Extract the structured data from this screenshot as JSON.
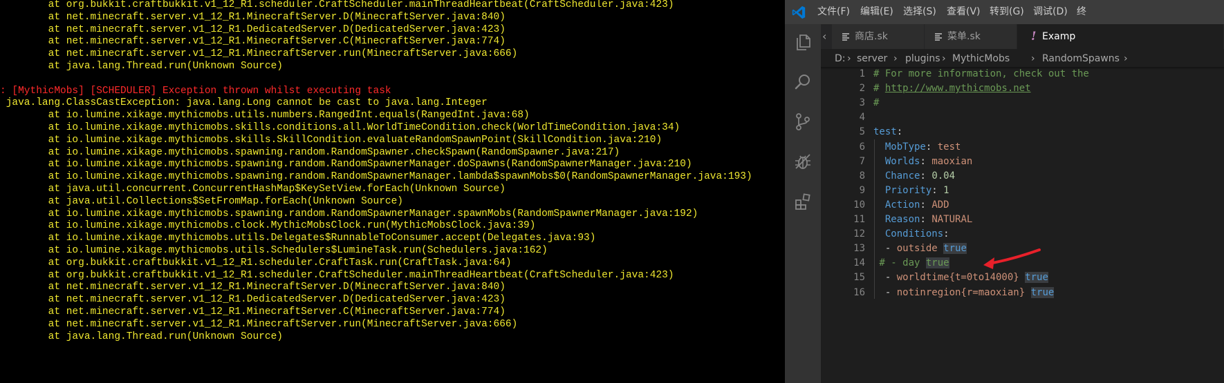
{
  "console": {
    "lines": [
      {
        "text": "        at org.bukkit.craftbukkit.v1_12_R1.scheduler.CraftScheduler.mainThreadHeartbeat(CraftScheduler.java:423)",
        "color": "yellow"
      },
      {
        "text": "        at net.minecraft.server.v1_12_R1.MinecraftServer.D(MinecraftServer.java:840)",
        "color": "yellow"
      },
      {
        "text": "        at net.minecraft.server.v1_12_R1.DedicatedServer.D(DedicatedServer.java:423)",
        "color": "yellow"
      },
      {
        "text": "        at net.minecraft.server.v1_12_R1.MinecraftServer.C(MinecraftServer.java:774)",
        "color": "yellow"
      },
      {
        "text": "        at net.minecraft.server.v1_12_R1.MinecraftServer.run(MinecraftServer.java:666)",
        "color": "yellow"
      },
      {
        "text": "        at java.lang.Thread.run(Unknown Source)",
        "color": "yellow"
      },
      {
        "text": "",
        "color": "yellow"
      },
      {
        "text": ": [MythicMobs] [SCHEDULER] Exception thrown whilst executing task",
        "color": "red"
      },
      {
        "text": " java.lang.ClassCastException: java.lang.Long cannot be cast to java.lang.Integer",
        "color": "yellow"
      },
      {
        "text": "        at io.lumine.xikage.mythicmobs.utils.numbers.RangedInt.equals(RangedInt.java:68)",
        "color": "yellow"
      },
      {
        "text": "        at io.lumine.xikage.mythicmobs.skills.conditions.all.WorldTimeCondition.check(WorldTimeCondition.java:34)",
        "color": "yellow"
      },
      {
        "text": "        at io.lumine.xikage.mythicmobs.skills.SkillCondition.evaluateRandomSpawnPoint(SkillCondition.java:210)",
        "color": "yellow"
      },
      {
        "text": "        at io.lumine.xikage.mythicmobs.spawning.random.RandomSpawner.checkSpawn(RandomSpawner.java:217)",
        "color": "yellow"
      },
      {
        "text": "        at io.lumine.xikage.mythicmobs.spawning.random.RandomSpawnerManager.doSpawns(RandomSpawnerManager.java:210)",
        "color": "yellow"
      },
      {
        "text": "        at io.lumine.xikage.mythicmobs.spawning.random.RandomSpawnerManager.lambda$spawnMobs$0(RandomSpawnerManager.java:193)",
        "color": "yellow"
      },
      {
        "text": "        at java.util.concurrent.ConcurrentHashMap$KeySetView.forEach(Unknown Source)",
        "color": "yellow"
      },
      {
        "text": "        at java.util.Collections$SetFromMap.forEach(Unknown Source)",
        "color": "yellow"
      },
      {
        "text": "        at io.lumine.xikage.mythicmobs.spawning.random.RandomSpawnerManager.spawnMobs(RandomSpawnerManager.java:192)",
        "color": "yellow"
      },
      {
        "text": "        at io.lumine.xikage.mythicmobs.clock.MythicMobsClock.run(MythicMobsClock.java:39)",
        "color": "yellow"
      },
      {
        "text": "        at io.lumine.xikage.mythicmobs.utils.Delegates$RunnableToConsumer.accept(Delegates.java:93)",
        "color": "yellow"
      },
      {
        "text": "        at io.lumine.xikage.mythicmobs.utils.Schedulers$LumineTask.run(Schedulers.java:162)",
        "color": "yellow"
      },
      {
        "text": "        at org.bukkit.craftbukkit.v1_12_R1.scheduler.CraftTask.run(CraftTask.java:64)",
        "color": "yellow"
      },
      {
        "text": "        at org.bukkit.craftbukkit.v1_12_R1.scheduler.CraftScheduler.mainThreadHeartbeat(CraftScheduler.java:423)",
        "color": "yellow"
      },
      {
        "text": "        at net.minecraft.server.v1_12_R1.MinecraftServer.D(MinecraftServer.java:840)",
        "color": "yellow"
      },
      {
        "text": "        at net.minecraft.server.v1_12_R1.DedicatedServer.D(DedicatedServer.java:423)",
        "color": "yellow"
      },
      {
        "text": "        at net.minecraft.server.v1_12_R1.MinecraftServer.C(MinecraftServer.java:774)",
        "color": "yellow"
      },
      {
        "text": "        at net.minecraft.server.v1_12_R1.MinecraftServer.run(MinecraftServer.java:666)",
        "color": "yellow"
      },
      {
        "text": "        at java.lang.Thread.run(Unknown Source)",
        "color": "yellow"
      }
    ]
  },
  "colors": {
    "console_yellow": "#f0e830",
    "console_red": "#ff2a2a",
    "vscode_blue": "#0078d4",
    "arrow_red": "#e8202a"
  },
  "vscode": {
    "menu": [
      "文件(F)",
      "编辑(E)",
      "选择(S)",
      "查看(V)",
      "转到(G)",
      "调试(D)",
      "终"
    ],
    "activity_icons": [
      "files-icon",
      "search-icon",
      "source-control-icon",
      "debug-icon",
      "extensions-icon"
    ],
    "tabs": [
      {
        "label": "商店.sk",
        "icon": "lines-icon",
        "active": false
      },
      {
        "label": "菜单.sk",
        "icon": "lines-icon",
        "active": false
      },
      {
        "label": "Examp",
        "icon": "exclamation-icon",
        "active": true
      }
    ],
    "tab_scroll_glyph": "‹",
    "breadcrumb": [
      "D:",
      "server",
      "plugins",
      "MythicMobs",
      "RandomSpawns"
    ],
    "code_lines": [
      {
        "n": "1",
        "text": "# For more information, check out the"
      },
      {
        "n": "2",
        "text": "# http://www.mythicmobs.net"
      },
      {
        "n": "3",
        "text": "#"
      },
      {
        "n": "4",
        "text": ""
      },
      {
        "n": "5",
        "text": "test:"
      },
      {
        "n": "6",
        "text": "  MobType: test"
      },
      {
        "n": "7",
        "text": "  Worlds: maoxian"
      },
      {
        "n": "8",
        "text": "  Chance: 0.04"
      },
      {
        "n": "9",
        "text": "  Priority: 1"
      },
      {
        "n": "10",
        "text": "  Action: ADD"
      },
      {
        "n": "11",
        "text": "  Reason: NATURAL"
      },
      {
        "n": "12",
        "text": "  Conditions:"
      },
      {
        "n": "13",
        "text": "  - outside true"
      },
      {
        "n": "14",
        "text": " # - day true"
      },
      {
        "n": "15",
        "text": "  - worldtime{t=0to14000} true"
      },
      {
        "n": "16",
        "text": "  - notinregion{r=maoxian} true"
      }
    ]
  }
}
